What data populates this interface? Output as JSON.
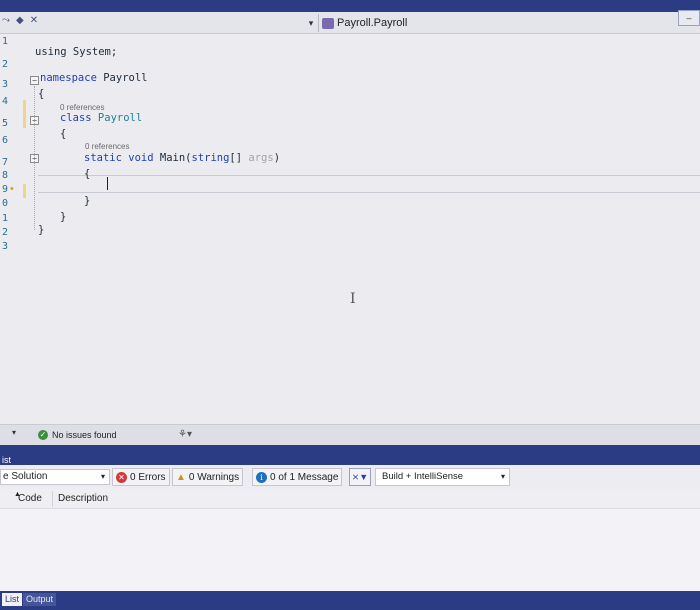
{
  "tab_strip": {
    "pin_icon": "pin-icon",
    "close_icon": "close-icon"
  },
  "navigation": {
    "member_combo": "Payroll.Payroll",
    "right_control": "–"
  },
  "editor": {
    "line_numbers": [
      "1",
      "2",
      "3",
      "4",
      "5",
      "6",
      "7",
      "8",
      "9",
      "0",
      "1",
      "2",
      "3"
    ],
    "lines": {
      "using": "using System;",
      "namespace_kw": "namespace",
      "namespace_name": " Payroll",
      "open_ns": "{",
      "class_refs": "0 references",
      "class_kw": "class",
      "class_name": " Payroll",
      "open_class": "{",
      "main_refs": "0 references",
      "main_static": "static",
      "main_void": " void",
      "main_name": " Main(",
      "main_string": "string",
      "main_brackets": "[] ",
      "main_args": "args",
      "main_close": ")",
      "open_main": "{",
      "close_main": "}",
      "close_class": "}",
      "close_ns": "}"
    },
    "lightbulb_icon": "lightbulb-icon"
  },
  "status_bar": {
    "issues_text": "No issues found",
    "brush_icon": "brush-icon"
  },
  "error_list": {
    "title": "ist",
    "scope": "e Solution",
    "errors": "0 Errors",
    "warnings": "0 Warnings",
    "messages": "0 of 1 Message",
    "build_filter": "Build + IntelliSense",
    "columns": {
      "code": "Code",
      "description": "Description"
    }
  },
  "bottom_tabs": {
    "list": "List",
    "output": "Output"
  },
  "colors": {
    "chrome_blue": "#2c3c84",
    "keyword": "#1f3fb0",
    "type": "#1e7f95",
    "error_red": "#d23a3a",
    "warning_yellow": "#c79a12",
    "info_blue": "#1f6fbf",
    "ok_green": "#3a8f3a"
  }
}
